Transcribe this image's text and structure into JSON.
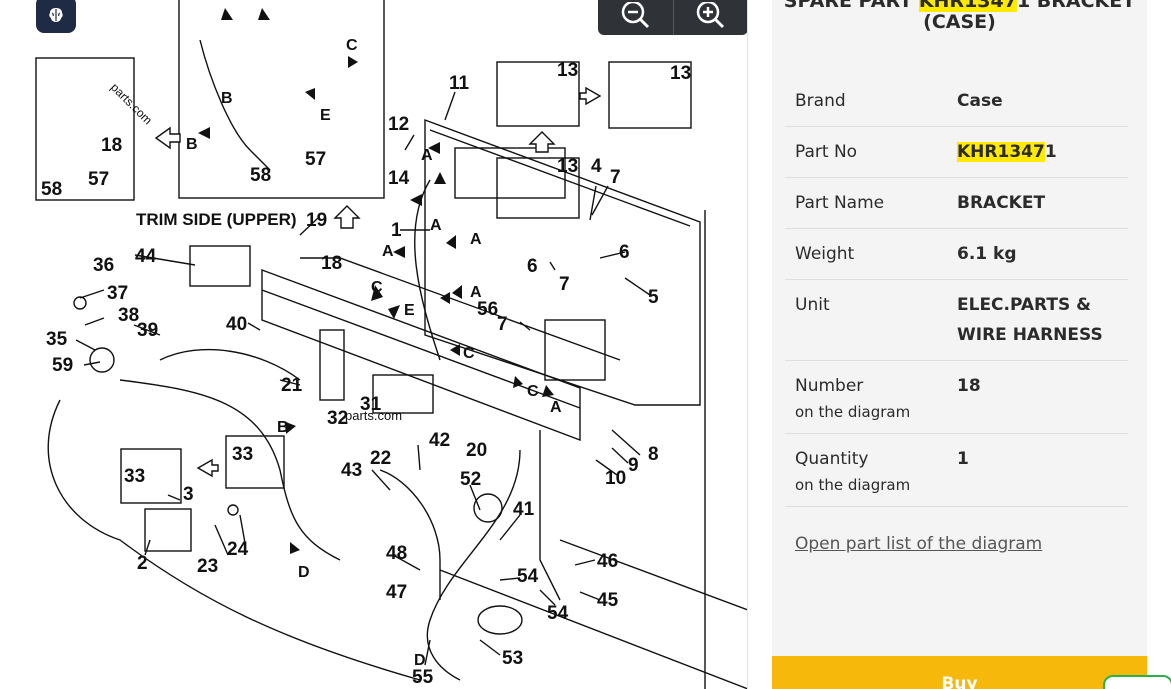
{
  "diagram": {
    "callouts": [
      {
        "text": "11"
      },
      {
        "text": "13"
      },
      {
        "text": "13"
      },
      {
        "text": "13"
      },
      {
        "text": "12"
      },
      {
        "text": "14"
      },
      {
        "text": "4"
      },
      {
        "text": "7"
      },
      {
        "text": "6"
      },
      {
        "text": "6"
      },
      {
        "text": "7"
      },
      {
        "text": "5"
      },
      {
        "text": "56"
      },
      {
        "text": "7"
      },
      {
        "text": "1"
      },
      {
        "text": "19"
      },
      {
        "text": "18"
      },
      {
        "text": "18"
      },
      {
        "text": "57"
      },
      {
        "text": "58"
      },
      {
        "text": "57"
      },
      {
        "text": "58"
      },
      {
        "text": "36"
      },
      {
        "text": "44"
      },
      {
        "text": "37"
      },
      {
        "text": "38"
      },
      {
        "text": "39"
      },
      {
        "text": "40"
      },
      {
        "text": "35"
      },
      {
        "text": "59"
      },
      {
        "text": "21"
      },
      {
        "text": "32"
      },
      {
        "text": "31"
      },
      {
        "text": "33"
      },
      {
        "text": "33"
      },
      {
        "text": "3"
      },
      {
        "text": "2"
      },
      {
        "text": "23"
      },
      {
        "text": "24"
      },
      {
        "text": "42"
      },
      {
        "text": "20"
      },
      {
        "text": "22"
      },
      {
        "text": "43"
      },
      {
        "text": "52"
      },
      {
        "text": "41"
      },
      {
        "text": "48"
      },
      {
        "text": "47"
      },
      {
        "text": "54"
      },
      {
        "text": "54"
      },
      {
        "text": "46"
      },
      {
        "text": "45"
      },
      {
        "text": "53"
      },
      {
        "text": "55"
      },
      {
        "text": "8"
      },
      {
        "text": "9"
      },
      {
        "text": "10"
      }
    ],
    "letters": [
      {
        "text": "A"
      },
      {
        "text": "A"
      },
      {
        "text": "A"
      },
      {
        "text": "A"
      },
      {
        "text": "A"
      },
      {
        "text": "A"
      },
      {
        "text": "B"
      },
      {
        "text": "B"
      },
      {
        "text": "B"
      },
      {
        "text": "C"
      },
      {
        "text": "C"
      },
      {
        "text": "C"
      },
      {
        "text": "C"
      },
      {
        "text": "D"
      },
      {
        "text": "D"
      },
      {
        "text": "E"
      },
      {
        "text": "E"
      }
    ],
    "caption_trim_side": "TRIM SIDE (UPPER)",
    "watermarks": [
      "parts.com",
      "parts.com"
    ]
  },
  "toolbar": {
    "brain_icon": "brain-icon",
    "zoom_out_icon": "zoom-out-icon",
    "zoom_in_icon": "zoom-in-icon"
  },
  "panel": {
    "title_prefix": "SPARE PART ",
    "title_highlight": "KHR1347",
    "title_rest_line1": "1 BRACKET",
    "title_line2": "(CASE)",
    "highlight_color": "#ffea00",
    "rows": [
      {
        "label": "Brand",
        "sub": "",
        "value": "Case"
      },
      {
        "label": "Part No",
        "sub": "",
        "value_highlight": "KHR1347",
        "value_rest": "1"
      },
      {
        "label": "Part Name",
        "sub": "",
        "value": "BRACKET"
      },
      {
        "label": "Weight",
        "sub": "",
        "value": "6.1 kg"
      },
      {
        "label": "Unit",
        "sub": "",
        "value": "ELEC.PARTS & WIRE HARNESS"
      },
      {
        "label": "Number",
        "sub": "on the diagram",
        "value": "18"
      },
      {
        "label": "Quantity",
        "sub": "on the diagram",
        "value": "1"
      }
    ],
    "part_list_link": "Open part list of the diagram",
    "buy_label": "Buy",
    "buy_color": "#f6b80a"
  }
}
